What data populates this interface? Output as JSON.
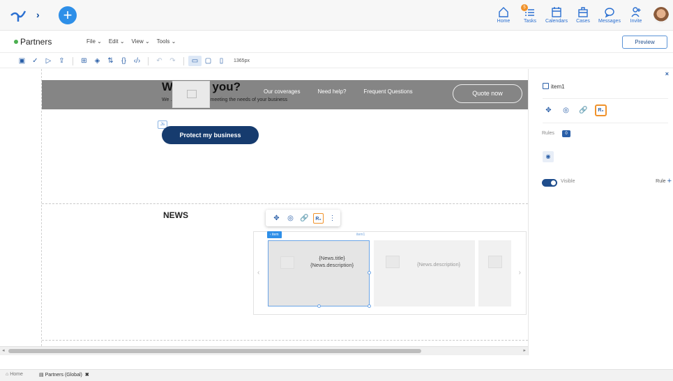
{
  "topbar": {
    "nav": [
      {
        "label": "Home",
        "icon": "home-icon"
      },
      {
        "label": "Tasks",
        "icon": "tasks-icon",
        "badge": "5"
      },
      {
        "label": "Calendars",
        "icon": "calendar-icon"
      },
      {
        "label": "Cases",
        "icon": "briefcase-icon"
      },
      {
        "label": "Messages",
        "icon": "message-icon"
      },
      {
        "label": "Invite",
        "icon": "invite-icon"
      }
    ]
  },
  "menubar": {
    "app_title": "Partners",
    "menus": [
      "File ⌄",
      "Edit ⌄",
      "View ⌄",
      "Tools ⌄"
    ],
    "preview_label": "Preview"
  },
  "toolbar": {
    "width_label": "1365px"
  },
  "canvas": {
    "banner": {
      "title": "We offer you?",
      "subtitle": "We ... nce focused on meeting the needs of your business",
      "links": [
        "Our coverages",
        "Need help?",
        "Frequent Questions"
      ],
      "quote_label": "Quote now"
    },
    "js_tag": "Js",
    "protect_label": "Protect my business",
    "news_title": "NEWS",
    "carousel": {
      "item_tag": "‹ item",
      "item_name": "item1",
      "card1_title": "{News.title}",
      "card1_desc": "{News.description}",
      "card2_desc": "{News.description}"
    }
  },
  "panel": {
    "item_name": "item1",
    "rules_label": "Rules",
    "rules_count": "0",
    "visible_label": "Visible",
    "rule_label": "Rule"
  },
  "bottom_tabs": {
    "home": "Home",
    "partners": "Partners (Global)"
  },
  "colors": {
    "accent": "#2e8fe8",
    "navy": "#163b6e",
    "highlight": "#f0922b"
  }
}
